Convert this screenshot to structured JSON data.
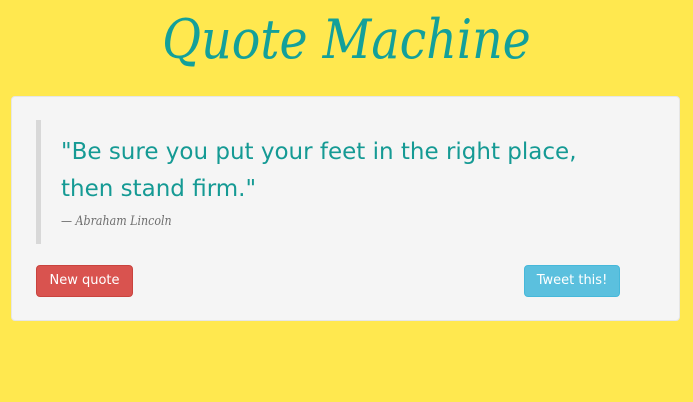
{
  "header": {
    "title": "Quote Machine"
  },
  "quote": {
    "text": "\"Be sure you put your feet in the right place, then stand firm.\"",
    "author": "— Abraham Lincoln"
  },
  "actions": {
    "new_quote_label": "New quote",
    "tweet_label": "Tweet this!"
  },
  "colors": {
    "background": "#ffe84f",
    "accent": "#13a09a",
    "card": "#f5f5f5",
    "new_quote_button": "#d9534f",
    "tweet_button": "#5bc0de"
  }
}
